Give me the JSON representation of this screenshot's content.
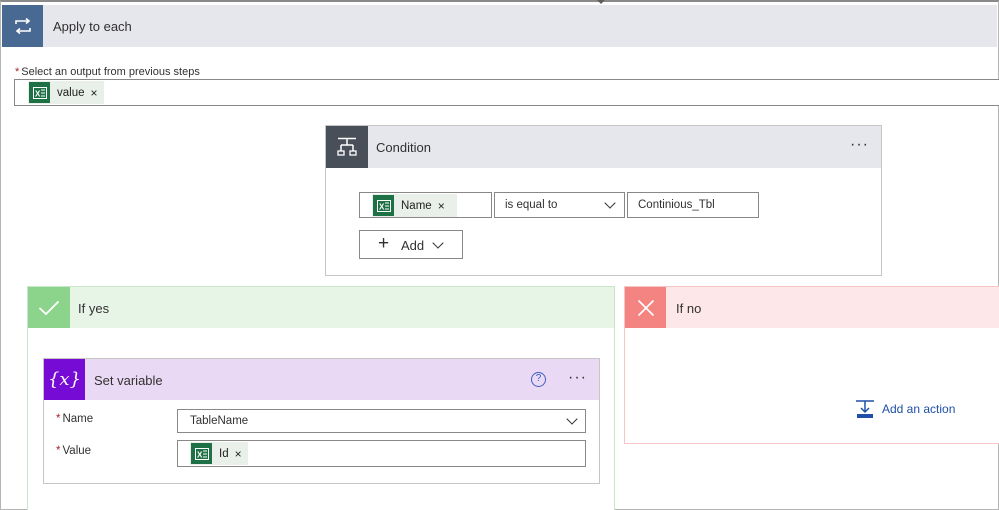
{
  "apply_to_each": {
    "title": "Apply to each",
    "field_label": "Select an output from previous steps",
    "required_mark": "*",
    "token": {
      "label": "value",
      "remove": "×",
      "icon": "excel-icon"
    }
  },
  "condition": {
    "title": "Condition",
    "more": "···",
    "left_token": {
      "label": "Name",
      "remove": "×",
      "icon": "excel-icon"
    },
    "operator": "is equal to",
    "right_value": "Continious_Tbl",
    "add_button": {
      "plus": "+",
      "label": "Add"
    }
  },
  "if_yes": {
    "title": "If yes",
    "set_variable": {
      "title": "Set variable",
      "icon_text": "{x}",
      "help": "?",
      "more": "···",
      "name_label": "Name",
      "name_value": "TableName",
      "value_label": "Value",
      "value_token": {
        "label": "Id",
        "remove": "×",
        "icon": "excel-icon"
      },
      "required_mark": "*"
    }
  },
  "if_no": {
    "title": "If no",
    "add_action_label": "Add an action"
  },
  "colors": {
    "apply_to_each_accent": "#486991",
    "condition_accent": "#484f58",
    "yes_accent": "#8cd48c",
    "no_accent": "#f48482",
    "variable_accent": "#770bd6",
    "excel_green": "#1e7145",
    "link_blue": "#1f4fa8"
  }
}
